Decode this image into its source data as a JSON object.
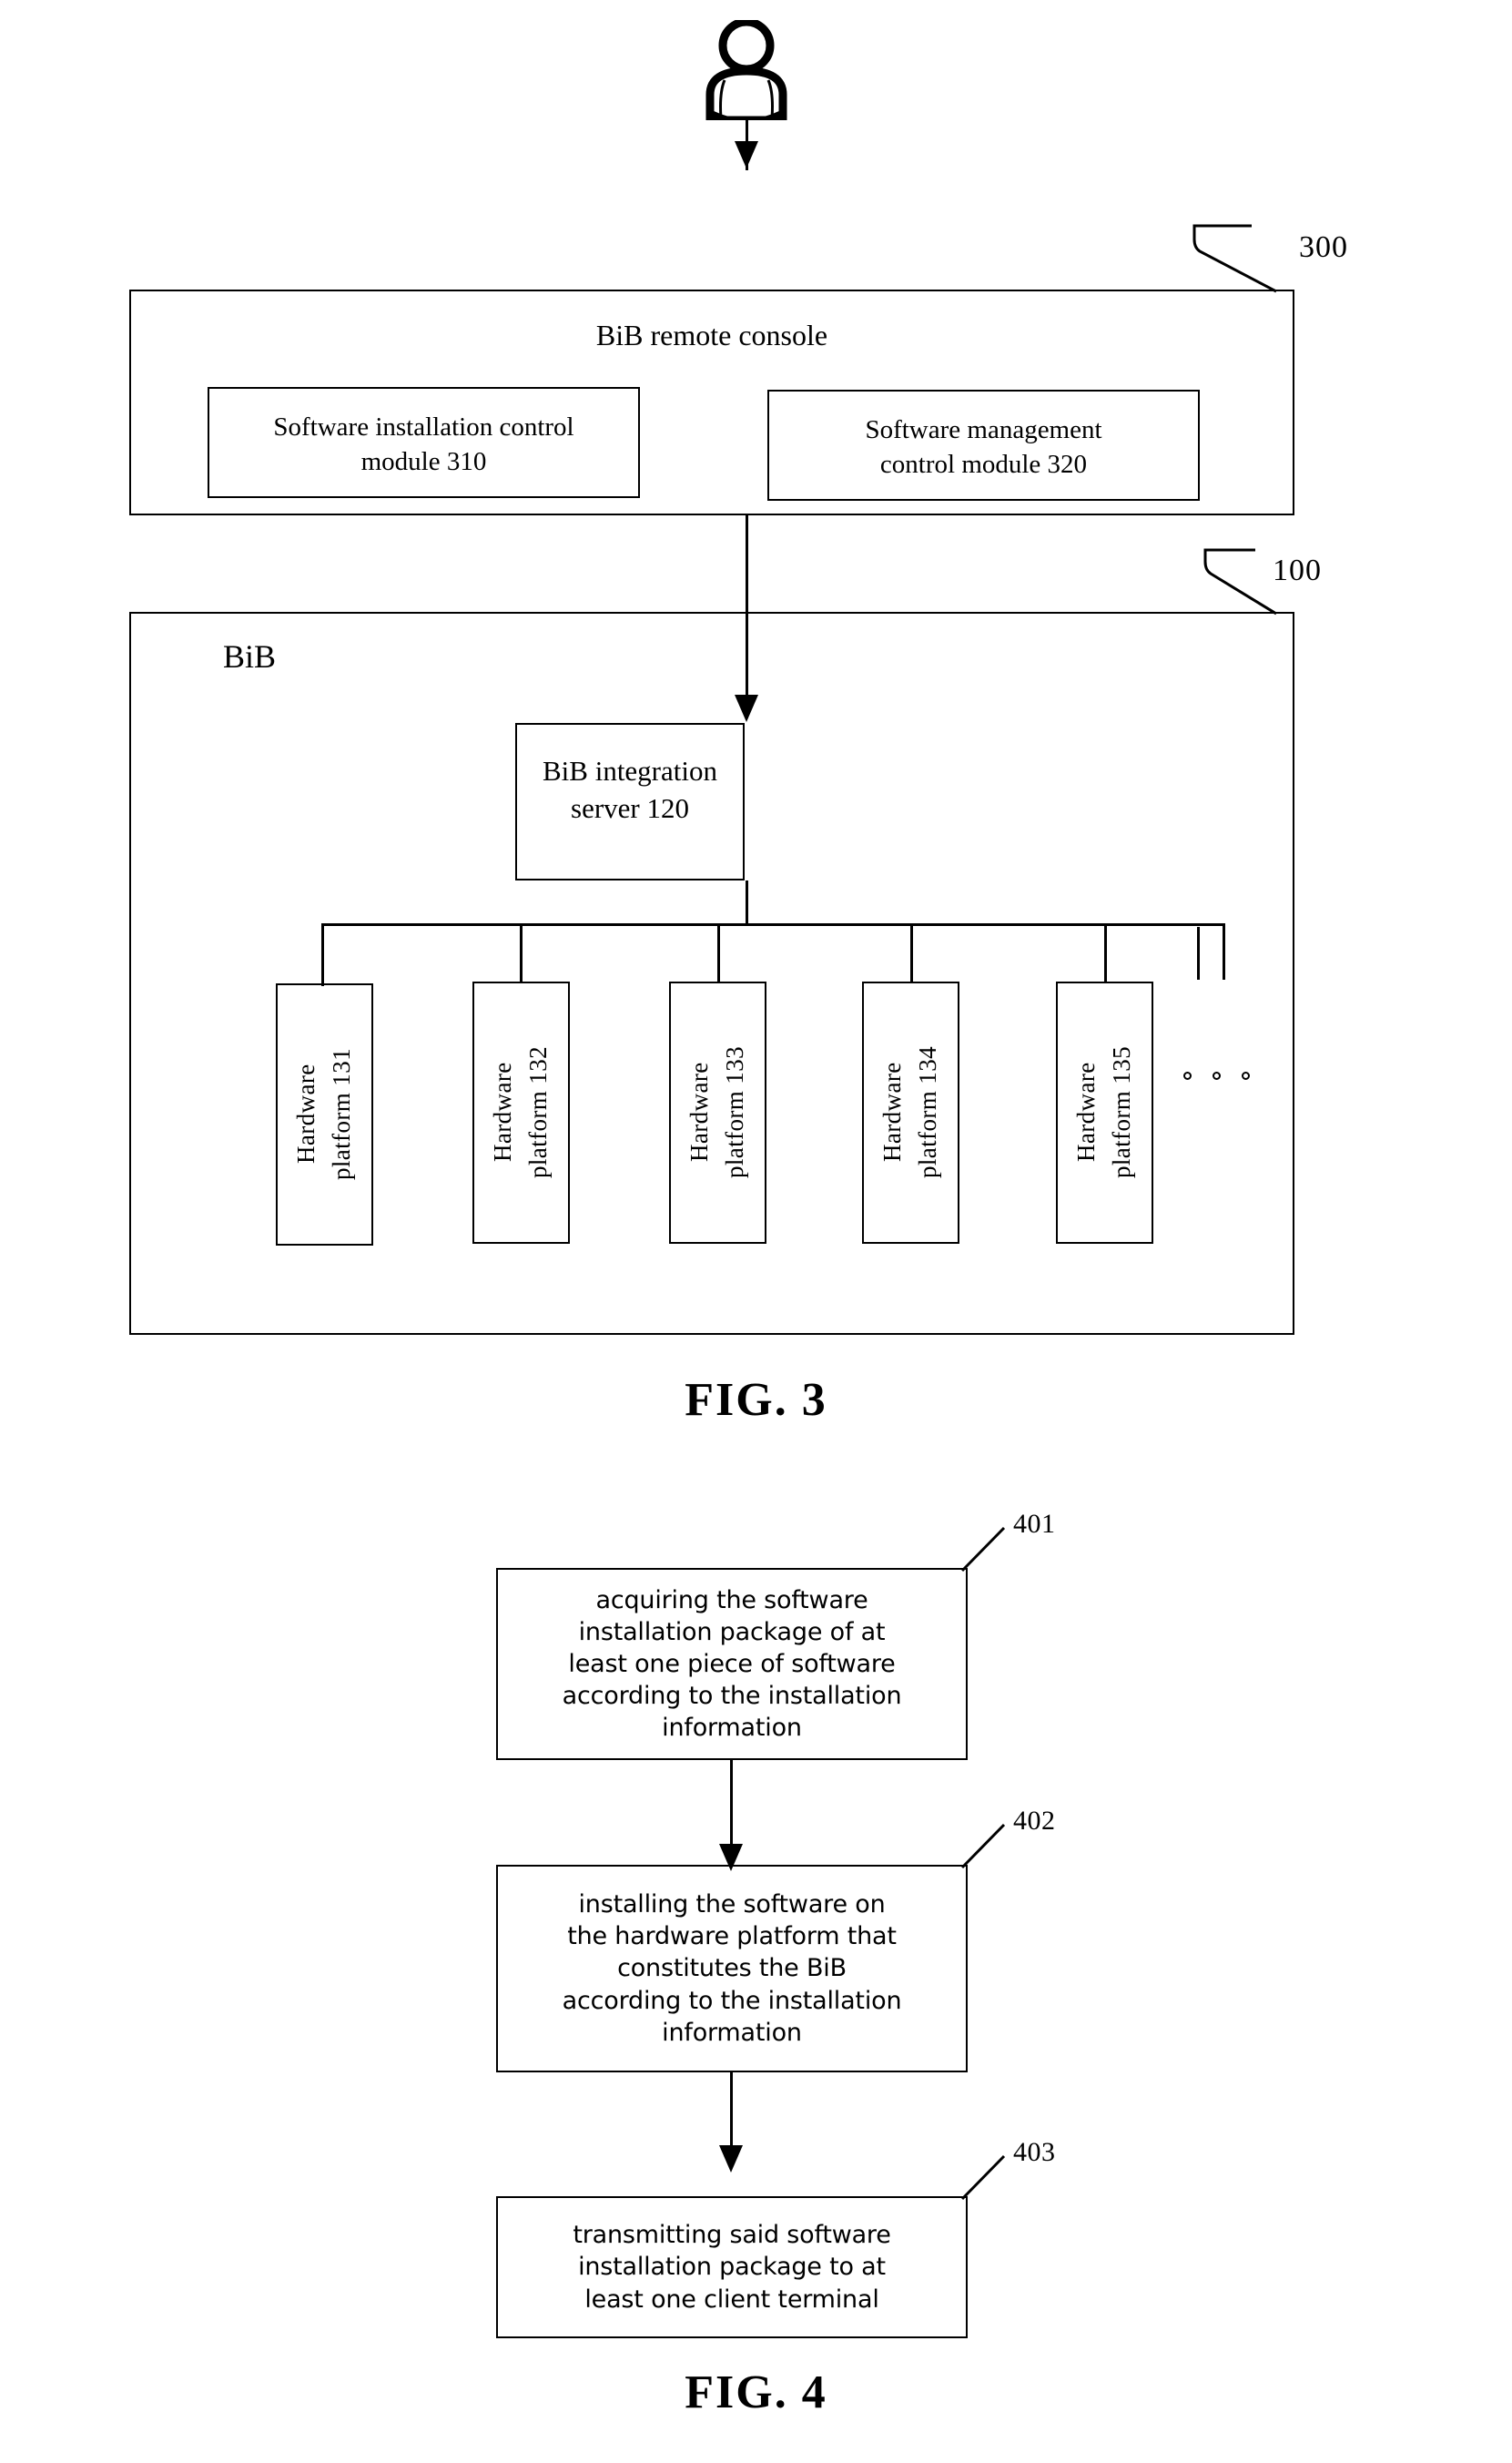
{
  "figures": [
    {
      "caption": "FIG. 3",
      "actor_icon": "user-person-icon",
      "console": {
        "ref": "300",
        "title": "BiB remote console",
        "modules": [
          {
            "label": "Software installation control\nmodule 310"
          },
          {
            "label": "Software management\ncontrol module 320"
          }
        ]
      },
      "bib": {
        "ref": "100",
        "title": "BiB",
        "server": {
          "label": "BiB integration\nserver 120"
        },
        "platforms": [
          {
            "label": "Hardware\nplatform 131"
          },
          {
            "label": "Hardware\nplatform 132"
          },
          {
            "label": "Hardware\nplatform 133"
          },
          {
            "label": "Hardware\nplatform 134"
          },
          {
            "label": "Hardware\nplatform 135"
          }
        ],
        "ellipsis": "○ ○ ○"
      }
    },
    {
      "caption": "FIG. 4",
      "steps": [
        {
          "ref": "401",
          "text": "acquiring the software\ninstallation package of at\nleast one piece of software\naccording to the installation\ninformation"
        },
        {
          "ref": "402",
          "text": "installing the  software on\nthe hardware platform that\nconstitutes the BiB\naccording to the installation\ninformation"
        },
        {
          "ref": "403",
          "text": "transmitting said software\ninstallation package to at\nleast one client terminal"
        }
      ]
    }
  ],
  "colors": {
    "ink": "#000000",
    "paper": "#ffffff"
  }
}
